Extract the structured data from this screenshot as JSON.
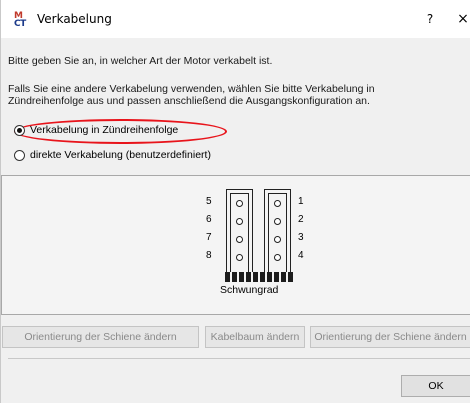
{
  "window": {
    "title": "Verkabelung",
    "icon_text_top": "M",
    "icon_text_bottom": "CT",
    "help_label": "?",
    "close_label": "×"
  },
  "instructions": {
    "intro": "Bitte geben Sie an, in welcher Art der Motor verkabelt ist.",
    "note_line1": "Falls Sie eine andere Verkabelung verwenden, wählen Sie bitte Verkabelung in",
    "note_line2": "Zündreihenfolge aus und passen anschließend die Ausgangskonfiguration an."
  },
  "wiring_options": [
    {
      "label": "Verkabelung in Zündreihenfolge",
      "selected": true
    },
    {
      "label": "direkte Verkabelung (benutzerdefiniert)",
      "selected": false
    }
  ],
  "diagram": {
    "left_cylinders": [
      "5",
      "6",
      "7",
      "8"
    ],
    "right_cylinders": [
      "1",
      "2",
      "3",
      "4"
    ],
    "flywheel_label": "Schwungrad"
  },
  "actions": {
    "rail_orientation_left": "Orientierung der Schiene ändern",
    "harness": "Kabelbaum ändern",
    "rail_orientation_right": "Orientierung der Schiene ändern"
  },
  "footer": {
    "ok_label": "OK"
  },
  "colors": {
    "highlight": "#e8141b",
    "icon_blue": "#1b3a8a",
    "icon_red": "#c0392b"
  }
}
